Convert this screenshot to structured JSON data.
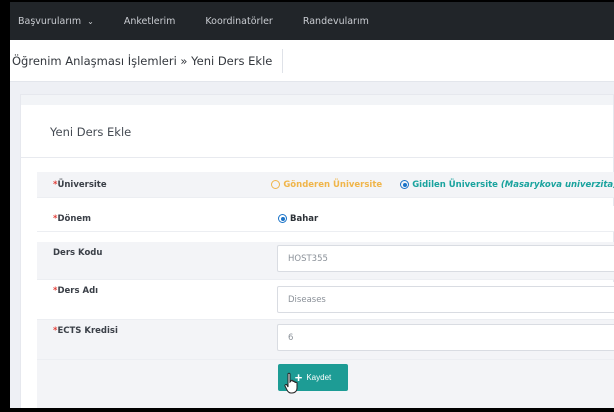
{
  "navbar": {
    "items": [
      {
        "label": "Başvurularım",
        "has_dropdown": true
      },
      {
        "label": "Anketlerim"
      },
      {
        "label": "Koordinatörler"
      },
      {
        "label": "Randevularım"
      }
    ]
  },
  "breadcrumb": {
    "text": "Öğrenim Anlaşması İşlemleri » Yeni Ders Ekle"
  },
  "card": {
    "title": "Yeni Ders Ekle"
  },
  "form": {
    "required_mark": "*",
    "universite": {
      "label": "Üniversite",
      "required": true,
      "option_sending": "Gönderen Üniversite",
      "option_host": "Gidilen Üniversite",
      "option_host_name": "(Masarykova univerzita)",
      "selected": "host"
    },
    "donem": {
      "label": "Dönem",
      "required": true,
      "option": "Bahar",
      "selected": true
    },
    "ders_kodu": {
      "label": "Ders Kodu",
      "required": false,
      "value": "HOST355"
    },
    "ders_adi": {
      "label": "Ders Adı",
      "required": true,
      "value": "Diseases"
    },
    "ects": {
      "label": "ECTS Kredisi",
      "required": true,
      "value": "6"
    },
    "save_button": {
      "icon": "plus-icon",
      "label": "Kaydet"
    }
  },
  "colors": {
    "navbar_bg": "#212529",
    "accent_teal": "#1d9c95",
    "required_red": "#e2413b",
    "sending_option_orange": "#f0b54a",
    "radio_blue": "#1a73c8"
  }
}
